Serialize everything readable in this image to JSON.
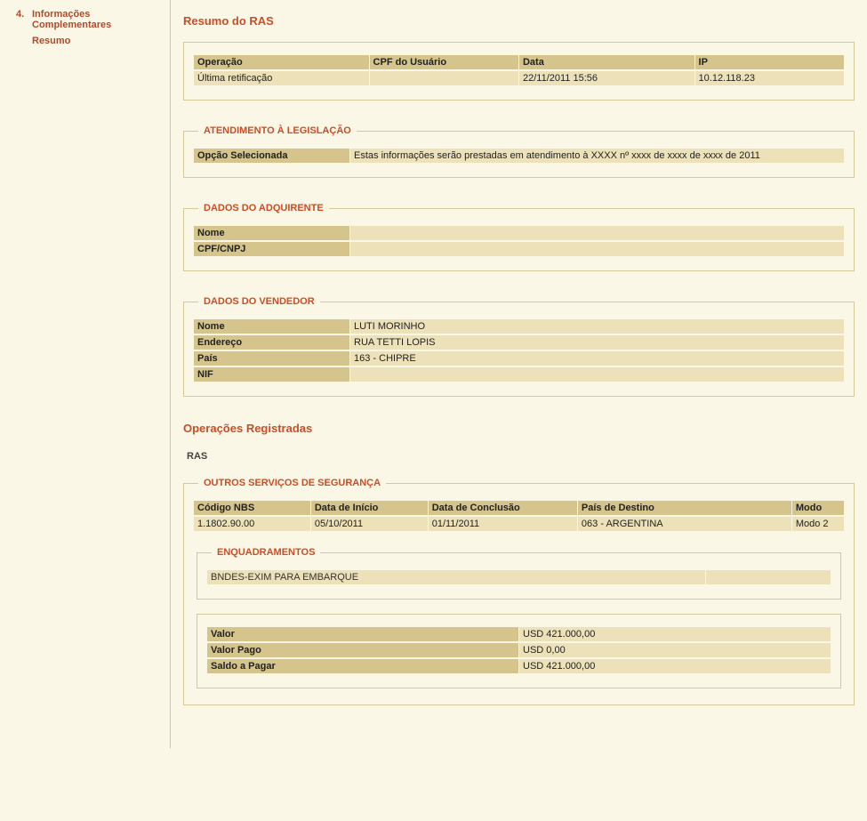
{
  "sidebar": {
    "items": [
      {
        "num": "4.",
        "label": "Informações Complementares"
      },
      {
        "num": "",
        "label": "Resumo"
      }
    ]
  },
  "titles": {
    "resumo": "Resumo do RAS",
    "legislacao": "ATENDIMENTO À LEGISLAÇÃO",
    "adquirente": "DADOS DO ADQUIRENTE",
    "vendedor": "DADOS DO VENDEDOR",
    "operacoes": "Operações Registradas",
    "ras": "RAS",
    "outros_servicos": "OUTROS SERVIÇOS DE SEGURANÇA",
    "enquadramentos": "ENQUADRAMENTOS"
  },
  "top_table": {
    "headers": [
      "Operação",
      "CPF do Usuário",
      "Data",
      "IP"
    ],
    "row": [
      "Última retificação",
      "",
      "22/11/2011 15:56",
      "10.12.118.23"
    ]
  },
  "legislacao": {
    "label": "Opção Selecionada",
    "value": "Estas informações serão prestadas em atendimento à XXXX nº xxxx de xxxx de xxxx de 2011"
  },
  "adquirente": {
    "nome_label": "Nome",
    "nome_value": "",
    "cpf_label": "CPF/CNPJ",
    "cpf_value": ""
  },
  "vendedor": {
    "nome_label": "Nome",
    "nome_value": "LUTI MORINHO",
    "end_label": "Endereço",
    "end_value": "RUA TETTI LOPIS",
    "pais_label": "País",
    "pais_value": "163 - CHIPRE",
    "nif_label": "NIF",
    "nif_value": ""
  },
  "servicos": {
    "headers": [
      "Código NBS",
      "Data de Início",
      "Data de Conclusão",
      "País de Destino",
      "Modo"
    ],
    "row": [
      "1.1802.90.00",
      "05/10/2011",
      "01/11/2011",
      "063 - ARGENTINA",
      "Modo 2"
    ]
  },
  "enquadramento": {
    "value": "BNDES-EXIM PARA EMBARQUE"
  },
  "valores": {
    "valor_label": "Valor",
    "valor_value": "USD 421.000,00",
    "pago_label": "Valor Pago",
    "pago_value": "USD 0,00",
    "saldo_label": "Saldo a Pagar",
    "saldo_value": "USD 421.000,00"
  }
}
